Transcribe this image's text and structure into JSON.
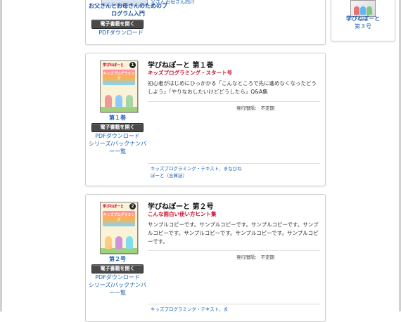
{
  "top_card": {
    "title": "お父さんとお母さんのためのプログラム入門",
    "open_label": "電子書籍を開く",
    "pdf_label": "PDFダウンロード",
    "note": "父さんお母さん向け"
  },
  "side_card": {
    "title_line1": "学びねぽーと",
    "title_line2": "第３号"
  },
  "books": [
    {
      "cover_number": "1",
      "cover_head": "学びねぽーと",
      "cover_band": "キッズプログラミング",
      "volume": "第１巻",
      "open_label": "電子書籍を開く",
      "pdf_label": "PDFダウンロード",
      "series_label": "シリーズ/バックナンバー一覧",
      "title": "学びねぽーと 第１巻",
      "subtitle": "キッズプログラミング・スタート号",
      "description": "初心者がはじめにひっかかる「こんなところで先に進めなくなったどうしよう」「やりなおしたいけどどうしたら」Q&A集",
      "frequency": "発行間隔： 不定期",
      "tags": "キッズプログラミング・テキスト、まなびねぽーと（合算誌）"
    },
    {
      "cover_number": "2",
      "cover_head": "学びねぽーと",
      "cover_band": "キッズプログラミング",
      "volume": "第２号",
      "open_label": "電子書籍を開く",
      "pdf_label": "PDFダウンロード",
      "series_label": "シリーズ/バックナンバー一覧",
      "title": "学びねぽーと 第２号",
      "subtitle": "こんな面白い使い方ヒント集",
      "description": "サンプルコピーです。サンプルコピーです。サンプルコピーです。サンプルコピーです。サンプルコピーです。サンプルコピーです。サンプルコピーです。",
      "frequency": "発行間隔： 不定期",
      "tags": "キッズプログラミング・テキスト、ま"
    }
  ],
  "colors": {
    "link": "#1a5fb4",
    "subtitle_red": "#c4122f",
    "button_dark": "#4a4a4a"
  }
}
